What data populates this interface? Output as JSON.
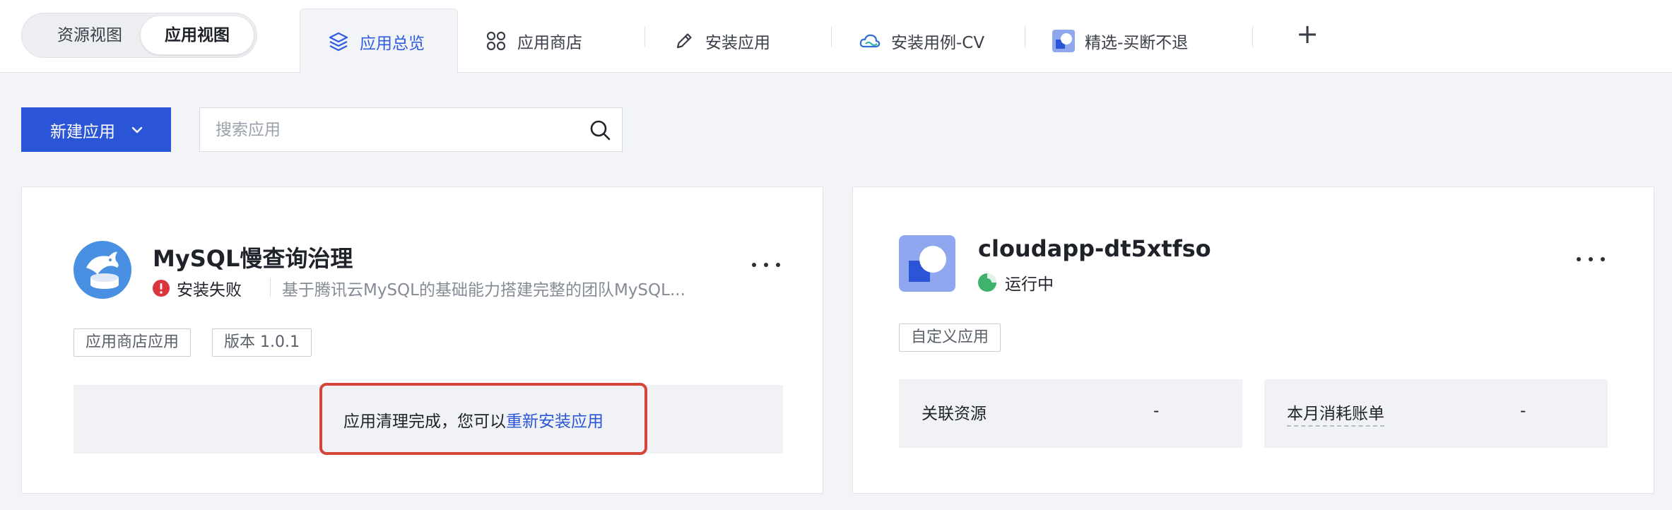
{
  "view_toggle": {
    "resource_view": "资源视图",
    "app_view": "应用视图"
  },
  "tabs": [
    {
      "label": "应用总览",
      "icon": "layers-icon",
      "active": true
    },
    {
      "label": "应用商店",
      "icon": "apps-grid-icon",
      "active": false
    },
    {
      "label": "安装应用",
      "icon": "pencil-icon",
      "active": false
    },
    {
      "label": "安装用例-CV",
      "icon": "cloud-icon",
      "active": false
    },
    {
      "label": "精选-买断不退",
      "icon": "app-logo-icon",
      "active": false
    }
  ],
  "add_tab_label": "+",
  "toolbar": {
    "new_app_label": "新建应用",
    "search_placeholder": "搜索应用"
  },
  "cards": [
    {
      "name": "MySQL慢查询治理",
      "status": "安装失败",
      "status_color": "#d9363e",
      "description": "基于腾讯云MySQL的基础能力搭建完整的团队MySQL...",
      "tags": [
        "应用商店应用",
        "版本 1.0.1"
      ],
      "notice_text": "应用清理完成，您可以",
      "notice_link": "重新安装应用"
    },
    {
      "name": "cloudapp-dt5xtfso",
      "status": "运行中",
      "status_color": "#3fb36b",
      "tags": [
        "自定义应用"
      ],
      "info": [
        {
          "label": "关联资源",
          "value": "-"
        },
        {
          "label": "本月消耗账单",
          "value": "-"
        }
      ]
    }
  ],
  "colors": {
    "accent": "#2b55d7",
    "highlight_border": "#d4453a"
  }
}
